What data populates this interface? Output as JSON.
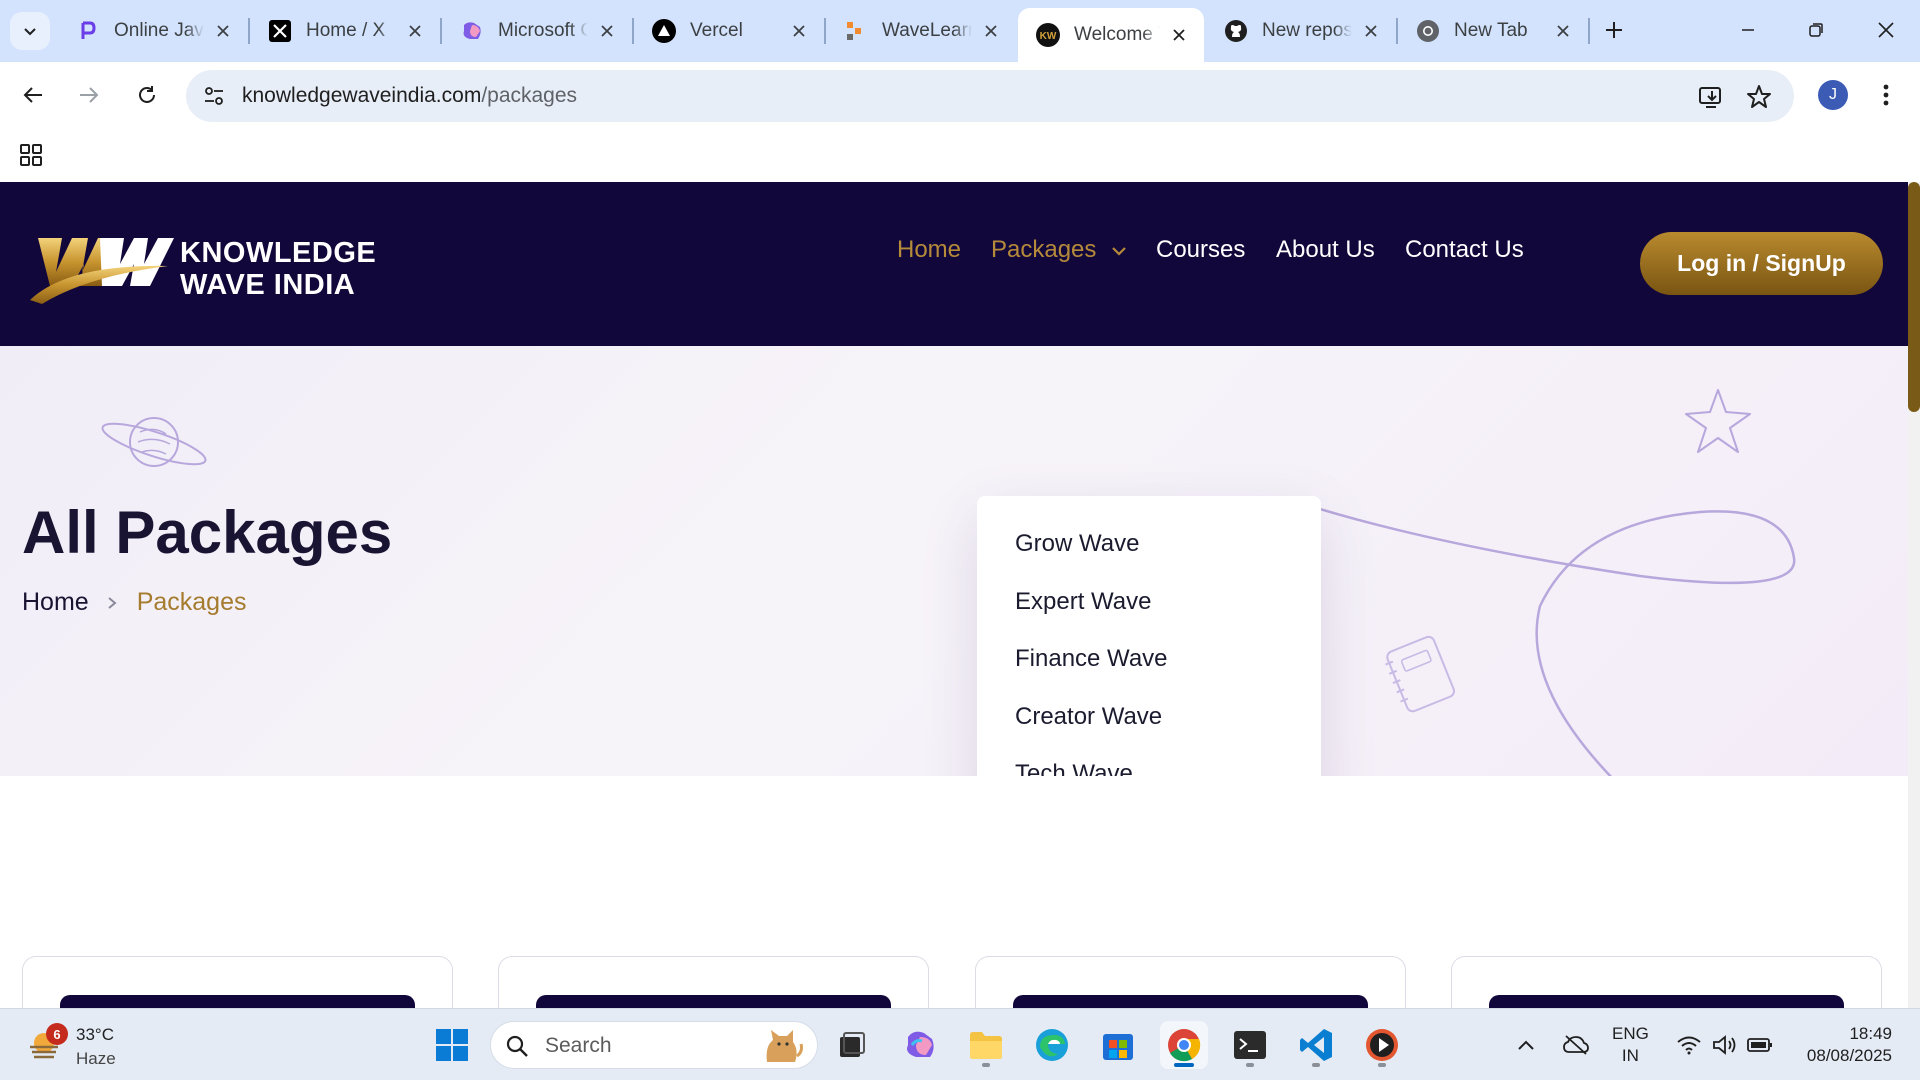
{
  "browser": {
    "tabs": [
      {
        "title": "Online Java",
        "icon": "p-logo-icon"
      },
      {
        "title": "Home / X",
        "icon": "x-logo-icon"
      },
      {
        "title": "Microsoft Copilot",
        "icon": "copilot-icon"
      },
      {
        "title": "Vercel",
        "icon": "vercel-icon"
      },
      {
        "title": "WaveLearn",
        "icon": "wavelearn-icon"
      },
      {
        "title": "Welcome To Knowledge Wave India",
        "icon": "kw-favicon-icon",
        "active": true
      },
      {
        "title": "New repository",
        "icon": "github-icon"
      },
      {
        "title": "New Tab",
        "icon": "chrome-icon"
      }
    ],
    "url_domain": "knowledgewaveindia.com",
    "url_path": "/packages",
    "profile_initial": "J"
  },
  "site": {
    "logo_line1": "KNOWLEDGE",
    "logo_line2": "WAVE INDIA",
    "nav": {
      "home": "Home",
      "packages": "Packages",
      "courses": "Courses",
      "about": "About Us",
      "contact": "Contact Us"
    },
    "login_label": "Log in / SignUp",
    "dropdown": [
      "Grow Wave",
      "Expert Wave",
      "Finance Wave",
      "Creator Wave",
      "Tech Wave"
    ],
    "hero_title": "All Packages",
    "breadcrumb": {
      "home": "Home",
      "current": "Packages"
    },
    "colors": {
      "header_bg": "#12073a",
      "gold": "#b58a3a",
      "hero_bg": "#f3eff8"
    }
  },
  "taskbar": {
    "weather": {
      "temp": "33°C",
      "condition": "Haze",
      "badge": "6"
    },
    "search_placeholder": "Search",
    "lang_line1": "ENG",
    "lang_line2": "IN",
    "time": "18:49",
    "date": "08/08/2025"
  }
}
